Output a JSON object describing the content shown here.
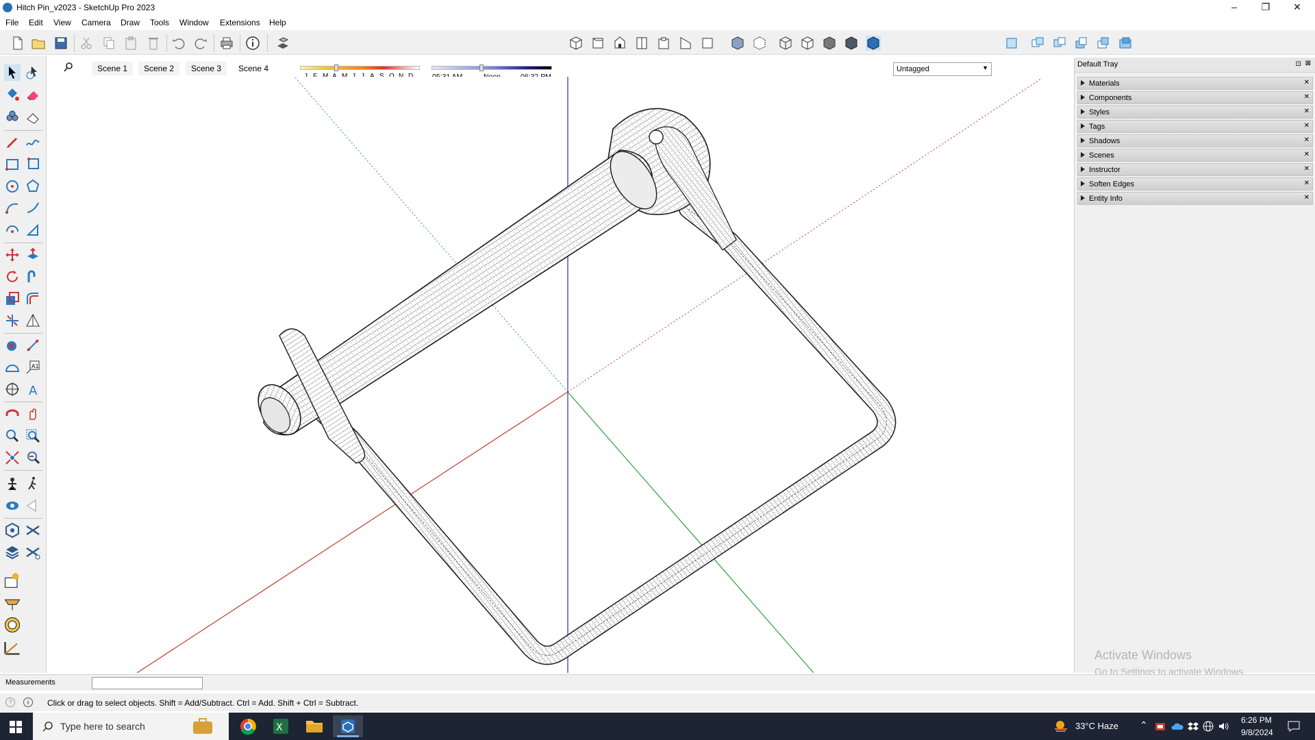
{
  "window": {
    "title": "Hitch Pin_v2023 - SketchUp Pro 2023",
    "minimize": "–",
    "restore": "❐",
    "close": "✕"
  },
  "menu": [
    "File",
    "Edit",
    "View",
    "Camera",
    "Draw",
    "Tools",
    "Window",
    "Extensions",
    "Help"
  ],
  "shadow": {
    "months": [
      "J",
      "F",
      "M",
      "A",
      "M",
      "J",
      "J",
      "A",
      "S",
      "O",
      "N",
      "D"
    ],
    "start_time": "05:31 AM",
    "mid_time": "Noon",
    "end_time": "06:32 PM"
  },
  "tag_selector": {
    "value": "Untagged"
  },
  "scenes": [
    "Scene 1",
    "Scene 2",
    "Scene 3",
    "Scene 4"
  ],
  "active_scene": "Scene 4",
  "tray": {
    "title": "Default Tray",
    "panels": [
      "Materials",
      "Components",
      "Styles",
      "Tags",
      "Shadows",
      "Scenes",
      "Instructor",
      "Soften Edges",
      "Entity Info"
    ]
  },
  "watermark": {
    "line1": "Activate Windows",
    "line2": "Go to Settings to activate Windows."
  },
  "measurements": {
    "label": "Measurements",
    "value": ""
  },
  "status_text": "Click or drag to select objects. Shift = Add/Subtract. Ctrl = Add. Shift + Ctrl = Subtract.",
  "taskbar": {
    "search_placeholder": "Type here to search",
    "weather": "33°C  Haze",
    "time": "6:26 PM",
    "date": "9/8/2024"
  },
  "colors": {
    "axis_red": "#c0392b",
    "axis_green": "#2e9e3a",
    "axis_blue": "#2c2ca8",
    "taskbar": "#1d2433"
  }
}
